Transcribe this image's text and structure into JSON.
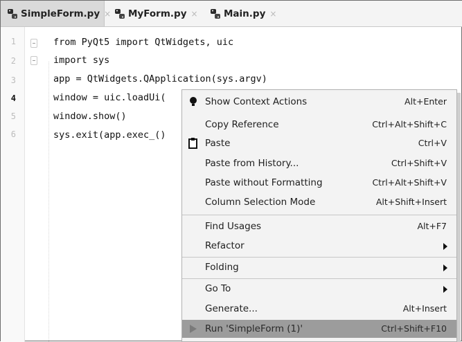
{
  "tabs": [
    {
      "name": "SimpleForm.py",
      "active": true
    },
    {
      "name": "MyForm.py",
      "active": false
    },
    {
      "name": "Main.py",
      "active": false
    }
  ],
  "tab_close_glyph": "×",
  "gutter": {
    "line_numbers": [
      "1",
      "2",
      "3",
      "4",
      "5",
      "6"
    ],
    "current_line": "4"
  },
  "code": {
    "line1": "from PyQt5 import QtWidgets, uic",
    "line2": "import sys",
    "line3": "app = QtWidgets.QApplication(sys.argv)",
    "line4": "window = uic.loadUi(",
    "line5": "window.show()",
    "line6": "sys.exit(app.exec_()"
  },
  "context_menu": {
    "items": [
      {
        "label": "Show Context Actions",
        "shortcut": "Alt+Enter",
        "icon": "lightbulb-icon"
      },
      {
        "label": "Copy Reference",
        "shortcut": "Ctrl+Alt+Shift+C"
      },
      {
        "label": "Paste",
        "shortcut": "Ctrl+V",
        "icon": "clipboard-icon"
      },
      {
        "label": "Paste from History...",
        "shortcut": "Ctrl+Shift+V"
      },
      {
        "label": "Paste without Formatting",
        "shortcut": "Ctrl+Alt+Shift+V"
      },
      {
        "label": "Column Selection Mode",
        "shortcut": "Alt+Shift+Insert"
      },
      {
        "label": "Find Usages",
        "shortcut": "Alt+F7"
      },
      {
        "label": "Refactor",
        "submenu": true
      },
      {
        "label": "Folding",
        "submenu": true
      },
      {
        "label": "Go To",
        "submenu": true
      },
      {
        "label": "Generate...",
        "shortcut": "Alt+Insert"
      },
      {
        "label": "Run 'SimpleForm (1)'",
        "shortcut": "Ctrl+Shift+F10",
        "selected": true,
        "icon": "run-icon"
      }
    ]
  },
  "colors": {
    "selected_item": "#9c9c9c",
    "menu_bg": "#f3f3f3",
    "active_tab": "#dadada"
  }
}
